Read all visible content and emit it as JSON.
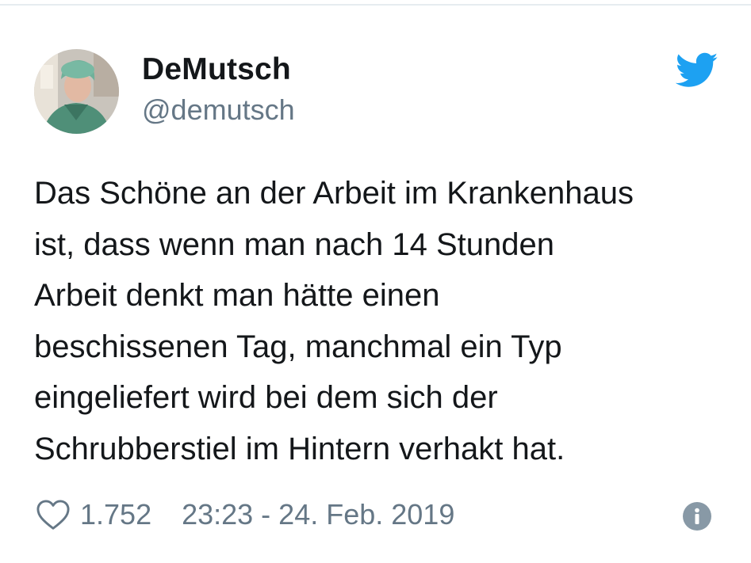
{
  "tweet": {
    "display_name": "DeMutsch",
    "handle": "@demutsch",
    "text_lines": [
      "Das Schöne an der Arbeit im Krankenhaus",
      "ist, dass wenn man nach 14 Stunden",
      "Arbeit denkt man hätte einen",
      "beschissenen Tag, manchmal ein Typ",
      "eingeliefert wird bei dem sich der",
      "Schrubberstiel im Hintern verhakt hat."
    ],
    "like_count": "1.752",
    "timestamp": "23:23 - 24. Feb. 2019"
  },
  "icons": {
    "brand": "twitter-bird-icon",
    "like": "heart-icon",
    "info": "info-icon"
  },
  "colors": {
    "brand_blue": "#1da1f2",
    "text_primary": "#14171a",
    "text_secondary": "#657786",
    "info_gray": "#8899a6"
  }
}
